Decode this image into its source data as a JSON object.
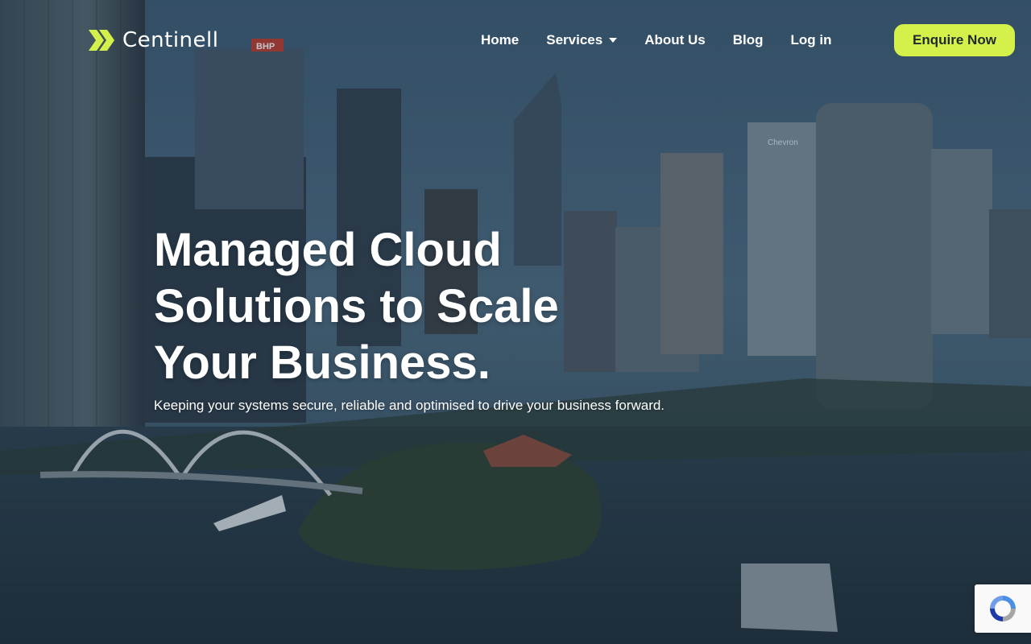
{
  "brand": {
    "name": "Centinell",
    "accent": "#d4f04a",
    "logo_icon": "double-chevron-right-icon"
  },
  "nav": {
    "items": [
      {
        "label": "Home"
      },
      {
        "label": "Services",
        "has_dropdown": true
      },
      {
        "label": "About Us"
      },
      {
        "label": "Blog"
      },
      {
        "label": "Log in"
      }
    ],
    "cta_label": "Enquire Now"
  },
  "hero": {
    "headline_lines": [
      "Managed Cloud",
      "Solutions to Scale",
      "Your Business."
    ],
    "subheadline": "Keeping your systems secure, reliable and optimised to drive your business forward.",
    "background": "aerial-city-skyline-waterfront",
    "building_signs": [
      "BHP",
      "Chevron"
    ]
  },
  "widgets": {
    "recaptcha_icon": "recaptcha-icon"
  },
  "colors": {
    "text": "#ffffff",
    "overlay": "#1e3346",
    "cta_text": "#1f2a30"
  }
}
